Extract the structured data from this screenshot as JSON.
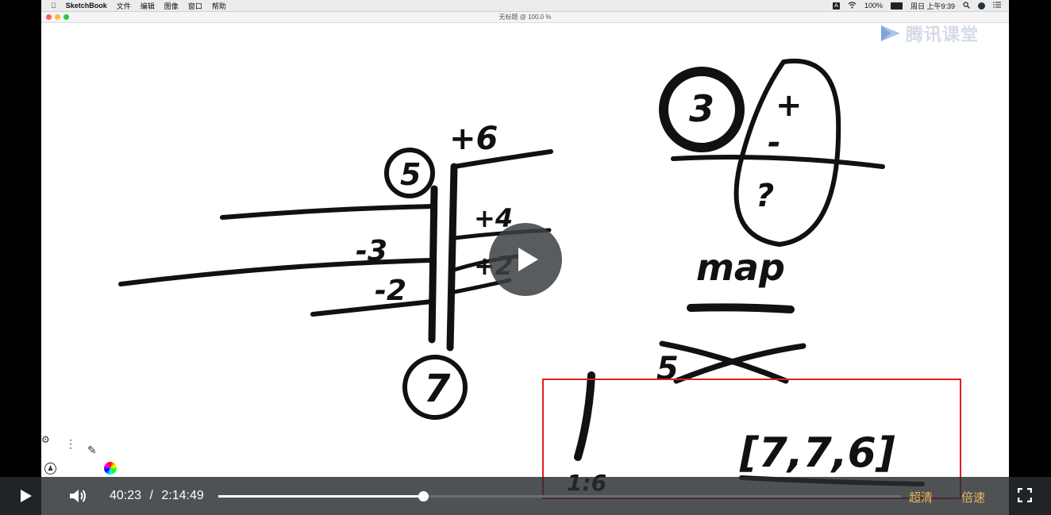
{
  "menubar": {
    "app_name": "SketchBook",
    "items": [
      "文件",
      "编辑",
      "图像",
      "窗口",
      "帮助"
    ],
    "status": {
      "battery": "100%",
      "datetime": "周日 上午9:39"
    }
  },
  "window": {
    "title": "无标题 @ 100.0 %"
  },
  "watermark": {
    "text": "腾讯课堂"
  },
  "colors": {
    "accent": "#e7b55b",
    "highlight_box": "#e02020",
    "control_bar": "#2c3034"
  },
  "player": {
    "current_time": "40:23",
    "separator": "/",
    "duration": "2:14:49",
    "progress_fraction": 0.2995,
    "quality_label": "超清",
    "speed_label": "倍速",
    "icons": {
      "play": "play-icon",
      "volume": "volume-icon",
      "fullscreen": "fullscreen-icon",
      "center_play": "play-icon"
    }
  },
  "sketch": {
    "left_diagram": {
      "top_label": "+6",
      "circle_top": "5",
      "circle_bottom": "7",
      "left_labels": [
        "-3",
        "-2"
      ],
      "right_labels": [
        "+4",
        "+2"
      ]
    },
    "right_diagram": {
      "circle": "3",
      "signs": [
        "+",
        "-",
        "?"
      ],
      "label_map": "map",
      "label_sx": "5",
      "bottom_left": "1:6",
      "bottom_array": "[7,7,6]"
    }
  }
}
